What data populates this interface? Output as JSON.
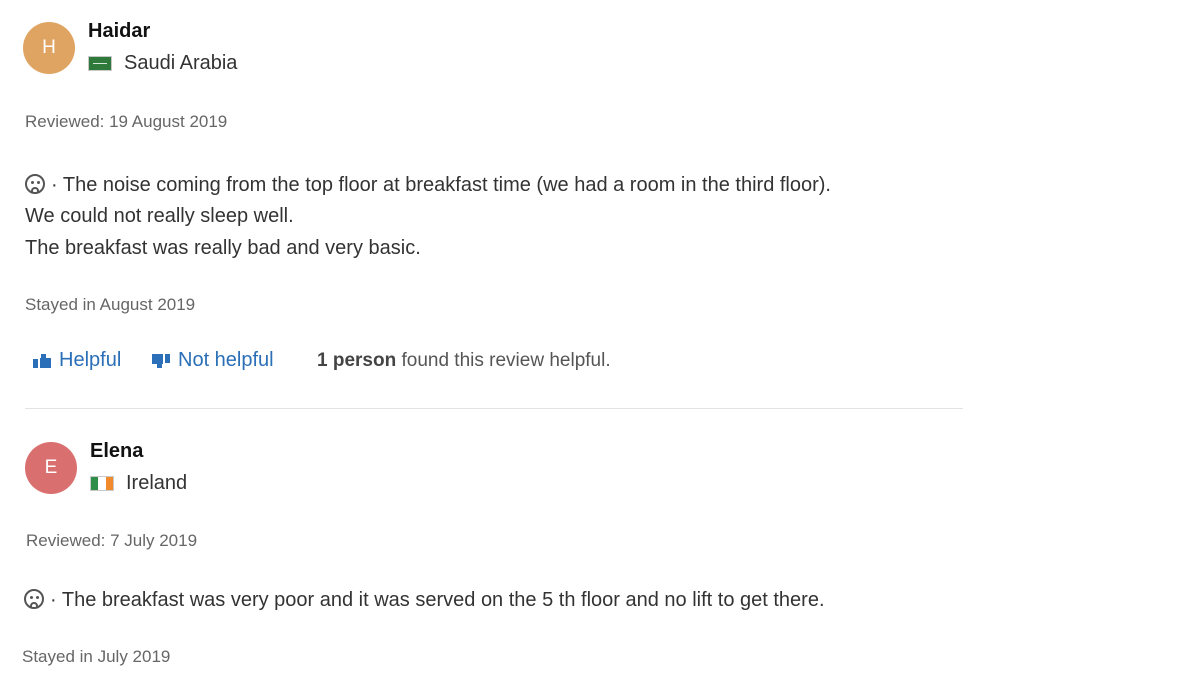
{
  "reviews": [
    {
      "initial": "H",
      "name": "Haidar",
      "country": "Saudi Arabia",
      "reviewed": "Reviewed: 19 August 2019",
      "lines": [
        "· The noise coming from the top floor at breakfast time (we had a room in the third floor).",
        "We could not really sleep well.",
        "The breakfast was really bad and very basic."
      ],
      "stayed": "Stayed in August 2019",
      "helpful_label": "Helpful",
      "not_helpful_label": "Not helpful",
      "found_count": "1 person",
      "found_text": " found this review helpful."
    },
    {
      "initial": "E",
      "name": "Elena",
      "country": "Ireland",
      "reviewed": "Reviewed: 7 July 2019",
      "lines": [
        "· The breakfast was very poor and it was served on the 5 th floor and no lift to get there."
      ],
      "stayed": "Stayed in July 2019"
    }
  ],
  "colors": {
    "avatar_haidar": "#e0a462",
    "avatar_elena": "#d96f6f",
    "link": "#2a6fb7",
    "flag_sa": "#2f7a3a",
    "flag_ie": [
      "#2f8f4a",
      "#ffffff",
      "#f08a2c"
    ]
  },
  "icons": {
    "negative": "frown-icon",
    "helpful": "thumbs-up-icon",
    "not_helpful": "thumbs-down-icon"
  }
}
